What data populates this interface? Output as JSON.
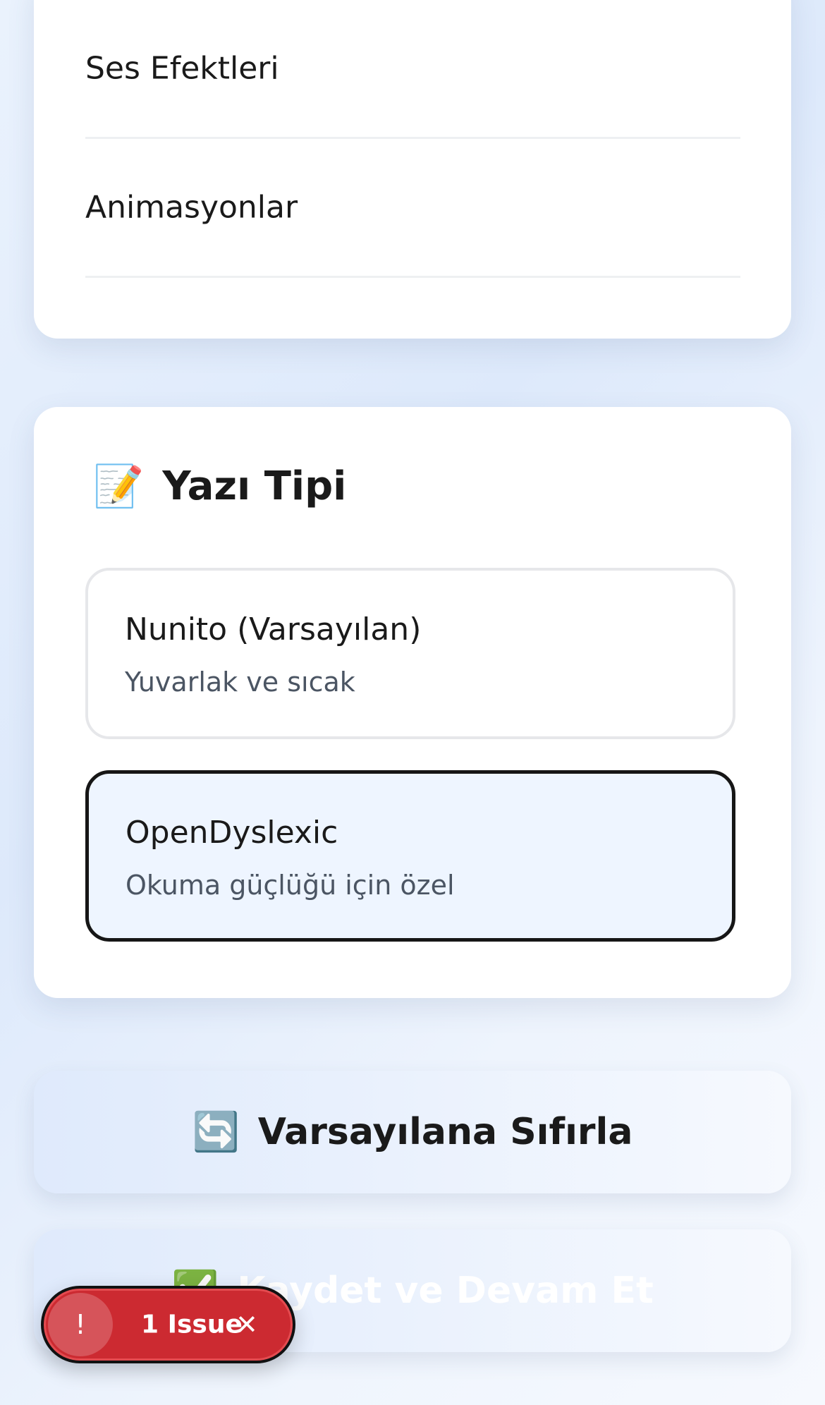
{
  "settings_list": {
    "items": [
      {
        "label": "Ses Efektleri"
      },
      {
        "label": "Animasyonlar"
      }
    ]
  },
  "font_section": {
    "icon": "memo-icon",
    "icon_glyph": "📝",
    "title": "Yazı Tipi",
    "options": [
      {
        "title": "Nunito (Varsayılan)",
        "subtitle": "Yuvarlak ve sıcak",
        "selected": false
      },
      {
        "title": "OpenDyslexic",
        "subtitle": "Okuma güçlüğü için özel",
        "selected": true
      }
    ]
  },
  "actions": {
    "reset": {
      "icon_glyph": "🔄",
      "label": "Varsayılana Sıfırla"
    },
    "save": {
      "icon_glyph": "✅",
      "label": "Kaydet ve Devam Et"
    }
  },
  "issue_badge": {
    "icon_glyph": "!",
    "label": "1 Issue",
    "close_glyph": "✕",
    "color": "#cc2a31"
  }
}
